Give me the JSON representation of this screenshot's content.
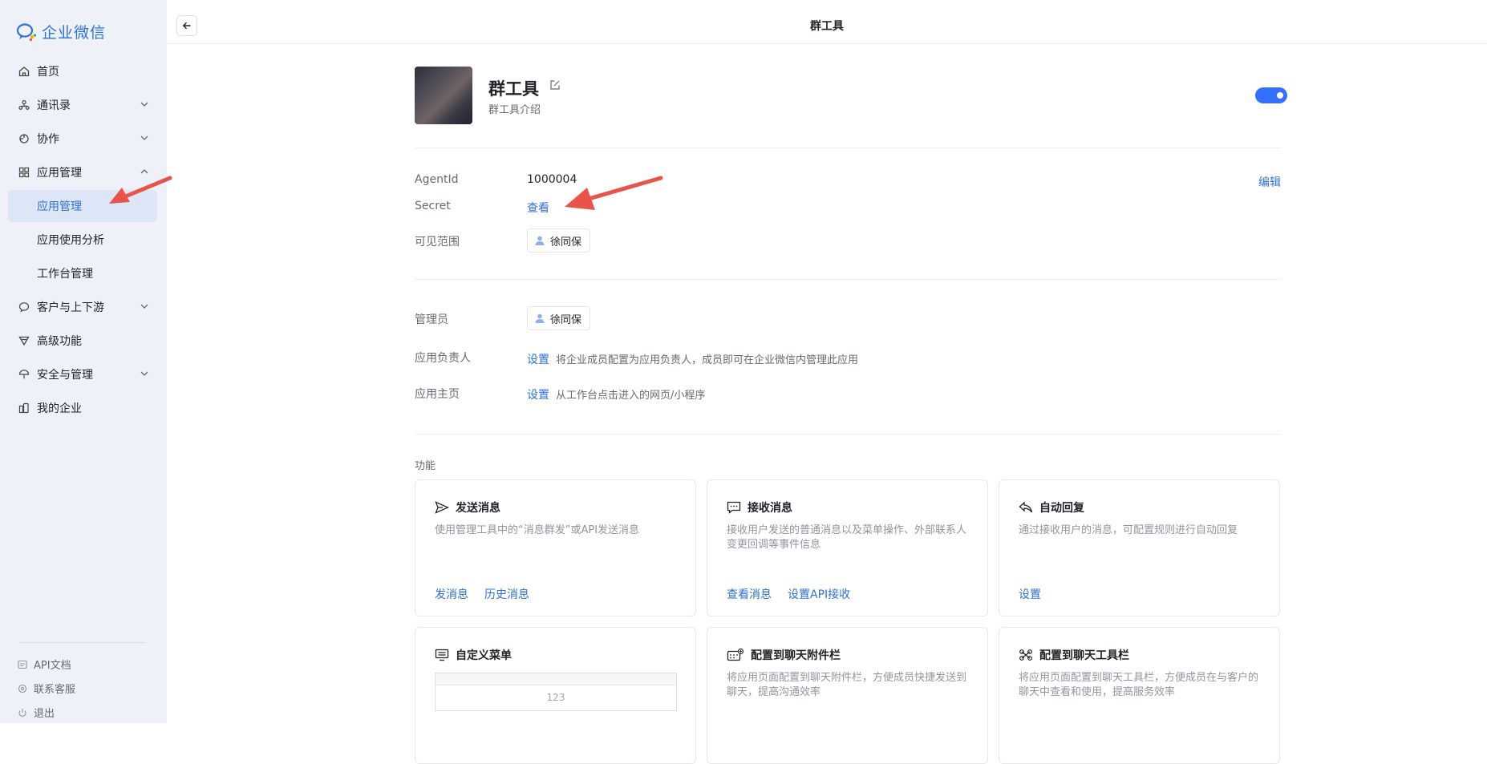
{
  "sidebar": {
    "brand": "企业微信",
    "items": [
      {
        "label": "首页",
        "icon": "home-icon"
      },
      {
        "label": "通讯录",
        "icon": "contacts-icon"
      },
      {
        "label": "协作",
        "icon": "collab-icon"
      },
      {
        "label": "应用管理",
        "icon": "apps-icon"
      },
      {
        "label": "应用管理"
      },
      {
        "label": "应用使用分析"
      },
      {
        "label": "工作台管理"
      },
      {
        "label": "客户与上下游",
        "icon": "chat-icon"
      },
      {
        "label": "高级功能",
        "icon": "advanced-icon"
      },
      {
        "label": "安全与管理",
        "icon": "umbrella-icon"
      },
      {
        "label": "我的企业",
        "icon": "building-icon"
      }
    ],
    "footer": [
      {
        "label": "API文档"
      },
      {
        "label": "联系客服"
      },
      {
        "label": "退出"
      }
    ]
  },
  "header": {
    "title": "群工具"
  },
  "app": {
    "name": "群工具",
    "description": "群工具介绍",
    "enabled": true
  },
  "details": {
    "agentid_label": "AgentId",
    "agentid_value": "1000004",
    "secret_label": "Secret",
    "secret_action": "查看",
    "edit_label": "编辑",
    "visible_label": "可见范围",
    "visible_user": "徐同保"
  },
  "admin": {
    "admin_label": "管理员",
    "admin_user": "徐同保",
    "owner_label": "应用负责人",
    "owner_action": "设置",
    "owner_hint": "将企业成员配置为应用负责人，成员即可在企业微信内管理此应用",
    "home_label": "应用主页",
    "home_action": "设置",
    "home_hint": "从工作台点击进入的网页/小程序"
  },
  "features": {
    "title": "功能",
    "cards": [
      {
        "title": "发送消息",
        "desc": "使用管理工具中的“消息群发”或API发送消息",
        "actions": [
          "发消息",
          "历史消息"
        ]
      },
      {
        "title": "接收消息",
        "desc": "接收用户发送的普通消息以及菜单操作、外部联系人变更回调等事件信息",
        "actions": [
          "查看消息",
          "设置API接收"
        ]
      },
      {
        "title": "自动回复",
        "desc": "通过接收用户的消息，可配置规则进行自动回复",
        "actions": [
          "设置"
        ]
      },
      {
        "title": "自定义菜单",
        "preview_value": "123"
      },
      {
        "title": "配置到聊天附件栏",
        "desc": "将应用页面配置到聊天附件栏，方便成员快捷发送到聊天，提高沟通效率"
      },
      {
        "title": "配置到聊天工具栏",
        "desc": "将应用页面配置到聊天工具栏，方便成员在与客户的聊天中查看和使用，提高服务效率"
      }
    ]
  },
  "colors": {
    "accent": "#2f6fd8",
    "sidebar_bg": "#eef1f8",
    "toggle_on": "#3370ff",
    "annotation_arrow": "#e8534a"
  }
}
